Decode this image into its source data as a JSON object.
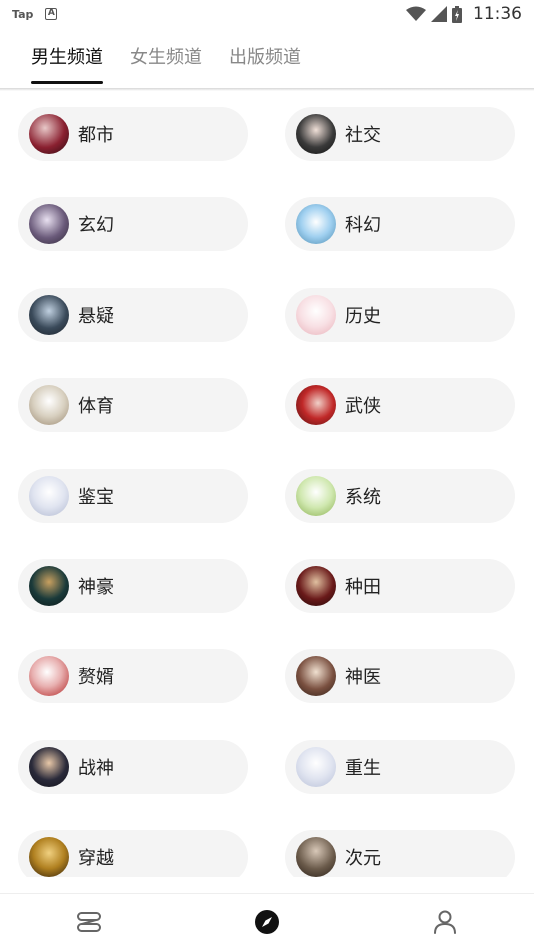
{
  "status_bar": {
    "left_text": "Tap",
    "app_icon": "A",
    "time": "11:36",
    "icons": [
      "wifi-icon",
      "signal-icon",
      "battery-icon"
    ]
  },
  "tabs": [
    {
      "label": "男生频道",
      "active": true
    },
    {
      "label": "女生频道",
      "active": false
    },
    {
      "label": "出版频道",
      "active": false
    }
  ],
  "categories": [
    {
      "label": "都市",
      "color": "#8a2030"
    },
    {
      "label": "社交",
      "color": "#3a3a3a"
    },
    {
      "label": "玄幻",
      "color": "#6a5a7a"
    },
    {
      "label": "科幻",
      "color": "#4a8ab0"
    },
    {
      "label": "悬疑",
      "color": "#3a4a5a"
    },
    {
      "label": "历史",
      "color": "#e8b0b8"
    },
    {
      "label": "体育",
      "color": "#9a8870"
    },
    {
      "label": "武侠",
      "color": "#c02828"
    },
    {
      "label": "鉴宝",
      "color": "#b0b8d0"
    },
    {
      "label": "系统",
      "color": "#8ab050"
    },
    {
      "label": "神豪",
      "color": "#1a3a3a"
    },
    {
      "label": "种田",
      "color": "#6a1a1a"
    },
    {
      "label": "赘婿",
      "color": "#b02020"
    },
    {
      "label": "神医",
      "color": "#7a5040"
    },
    {
      "label": "战神",
      "color": "#2a2a3a"
    },
    {
      "label": "重生",
      "color": "#b8c0d8"
    },
    {
      "label": "穿越",
      "color": "#b08020"
    },
    {
      "label": "次元",
      "color": "#6a5a4a"
    }
  ],
  "bottom_nav": [
    {
      "name": "bookshelf-icon"
    },
    {
      "name": "discover-compass-icon",
      "active": true
    },
    {
      "name": "profile-icon"
    }
  ]
}
